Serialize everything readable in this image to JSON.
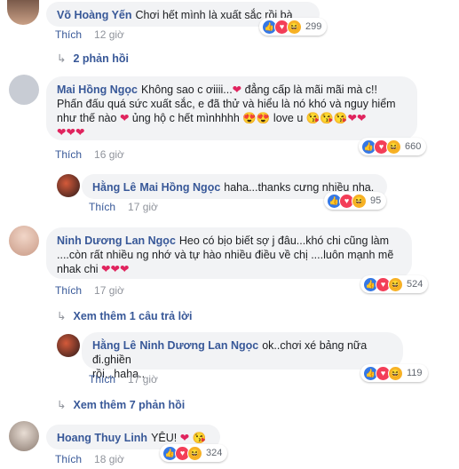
{
  "comments": [
    {
      "name": "Võ Hoàng Yến",
      "text": "Chơi hết mình là xuất sắc rồi bà",
      "like": "Thích",
      "time": "12 giờ",
      "count": "299"
    },
    {
      "name": "Mai Hồng Ngọc",
      "text": "Không sao c ơiiii...",
      "text2": " đẳng cấp là mãi mãi mà c!!",
      "line2": "Phấn đấu quá sức xuất sắc, e đã thử và hiểu là nó khó và nguy hiểm",
      "line3a": "như thế nào",
      "line3b": " ủng hộ c hết mìnhhhh",
      "line3c": " love u",
      "like": "Thích",
      "time": "16 giờ",
      "count": "660"
    },
    {
      "name": "Hằng Lê",
      "mention": "Mai Hồng Ngọc",
      "text": "haha...thanks cưng nhiều nha.",
      "like": "Thích",
      "time": "17 giờ",
      "count": "95"
    },
    {
      "name": "Ninh Dương Lan Ngọc",
      "text": "Heo có bịo biết sợ j đâu...khó chi cũng làm",
      "line2": "....còn rất nhiều ng nhớ và tự hào nhiều điều về chị ....luôn mạnh mẽ",
      "line3": "nhak chi",
      "like": "Thích",
      "time": "17 giờ",
      "count": "524"
    },
    {
      "name": "Hằng Lê",
      "mention": "Ninh Dương Lan Ngọc",
      "text": "ok..chơi xé bảng nữa đi.ghiền",
      "line2": "rồi...haha..",
      "like": "Thích",
      "time": "17 giờ",
      "count": "119"
    },
    {
      "name": "Hoang Thuy Linh",
      "text": "YÊU!",
      "like": "Thích",
      "time": "18 giờ",
      "count": "324"
    }
  ],
  "replies": {
    "first": "2 phản hồi",
    "second": "Xem thêm 1 câu trả lời",
    "third": "Xem thêm 7 phản hồi"
  },
  "colors": {
    "link": "#385898",
    "bubble": "#f2f3f5",
    "like": "#3578e5",
    "heart": "#f33e58",
    "haha": "#f7b125"
  }
}
